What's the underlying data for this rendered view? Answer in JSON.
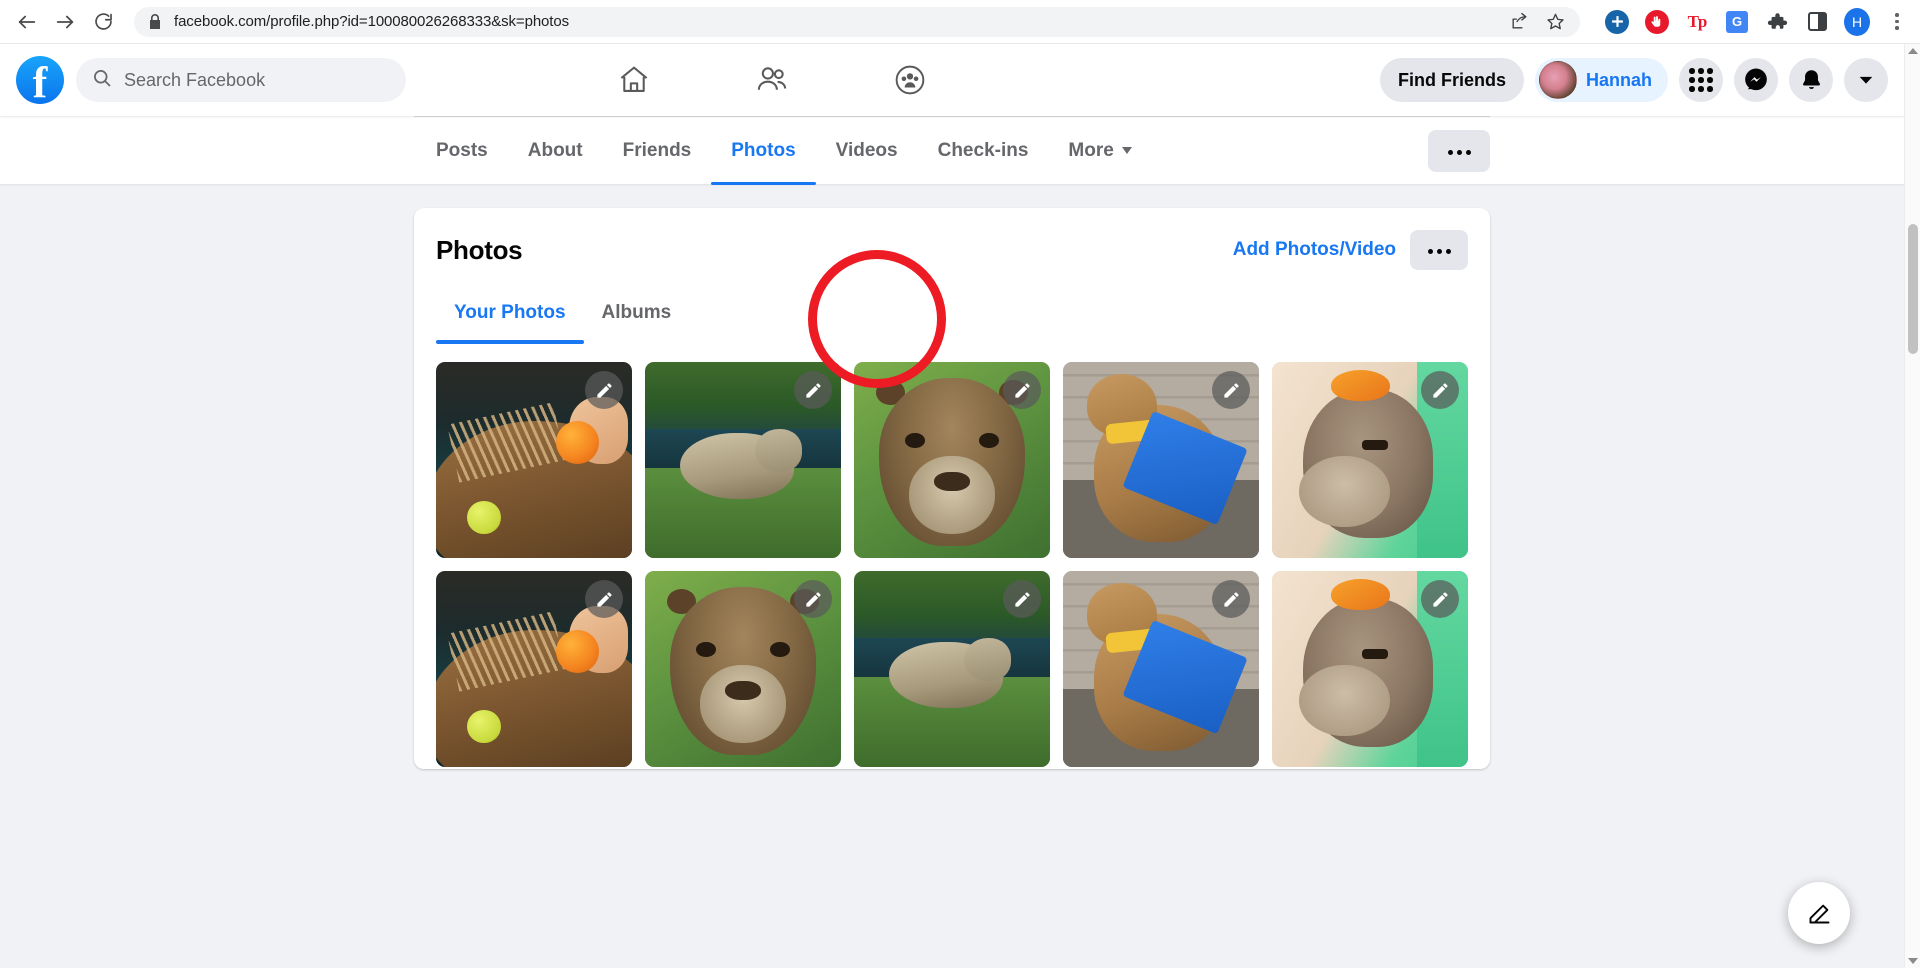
{
  "browser": {
    "back_icon": "back-arrow-icon",
    "forward_icon": "forward-arrow-icon",
    "reload_icon": "reload-icon",
    "lock_icon": "lock-icon",
    "url": "facebook.com/profile.php?id=100080026268333&sk=photos",
    "share_icon": "share-icon",
    "bookmark_icon": "star-icon",
    "extensions": [
      {
        "name": "colorzilla-extension-icon",
        "label": "",
        "color": "#1565a8"
      },
      {
        "name": "adblock-extension-icon",
        "label": "",
        "color": "#e8192c"
      },
      {
        "name": "textpower-extension-icon",
        "label": "Tp",
        "color": "#e8192c"
      },
      {
        "name": "google-translate-extension-icon",
        "label": "G",
        "color": "#4285f4"
      },
      {
        "name": "puzzle-extensions-icon",
        "label": "",
        "color": "#3c4043"
      },
      {
        "name": "side-panel-icon",
        "label": "",
        "color": "#3c4043"
      },
      {
        "name": "chrome-profile-avatar",
        "label": "H",
        "color": "#1a73e8"
      },
      {
        "name": "chrome-menu-kebab-icon",
        "label": "",
        "color": "#5f6368"
      }
    ]
  },
  "facebook_header": {
    "logo": "facebook-logo-icon",
    "search_placeholder": "Search Facebook",
    "search_icon": "search-icon",
    "nav_icons": [
      {
        "name": "home-icon"
      },
      {
        "name": "friends-icon"
      },
      {
        "name": "groups-icon"
      }
    ],
    "find_friends_label": "Find Friends",
    "profile_name": "Hannah",
    "right_icons": [
      {
        "name": "menu-grid-icon"
      },
      {
        "name": "messenger-icon"
      },
      {
        "name": "notifications-bell-icon"
      },
      {
        "name": "account-chevron-down-icon"
      }
    ]
  },
  "profile_nav": {
    "tabs": [
      {
        "label": "Posts",
        "active": false
      },
      {
        "label": "About",
        "active": false
      },
      {
        "label": "Friends",
        "active": false
      },
      {
        "label": "Photos",
        "active": true
      },
      {
        "label": "Videos",
        "active": false
      },
      {
        "label": "Check-ins",
        "active": false
      },
      {
        "label": "More",
        "active": false,
        "has_caret": true
      }
    ],
    "more_options_label": "..."
  },
  "photos_card": {
    "title": "Photos",
    "add_photos_label": "Add Photos/Video",
    "more_label": "...",
    "tabs": [
      {
        "label": "Your Photos",
        "active": true
      },
      {
        "label": "Albums",
        "active": false,
        "annotated": true
      }
    ],
    "annotation": {
      "shape": "circle",
      "color": "#ed1c24",
      "targets": "Albums"
    },
    "grid": {
      "columns": 5,
      "photos": [
        {
          "id": "photo-1",
          "alt": "Capybara in water with orange on head",
          "variant": "a",
          "edit_icon": "pencil-icon"
        },
        {
          "id": "photo-2",
          "alt": "Capybara resting on grass by pond",
          "variant": "b",
          "edit_icon": "pencil-icon"
        },
        {
          "id": "photo-3",
          "alt": "Capybara facing camera on green background",
          "variant": "c",
          "edit_icon": "pencil-icon"
        },
        {
          "id": "photo-4",
          "alt": "Capybara wearing blue and yellow scarf on stone wall",
          "variant": "d",
          "edit_icon": "pencil-icon"
        },
        {
          "id": "photo-5",
          "alt": "Capybara with orange duck on head",
          "variant": "e",
          "edit_icon": "pencil-icon"
        },
        {
          "id": "photo-6",
          "alt": "Capybara in water with orange on head",
          "variant": "a",
          "edit_icon": "pencil-icon"
        },
        {
          "id": "photo-7",
          "alt": "Capybara facing camera on green background",
          "variant": "c",
          "edit_icon": "pencil-icon"
        },
        {
          "id": "photo-8",
          "alt": "Capybara resting on grass by pond",
          "variant": "b",
          "edit_icon": "pencil-icon"
        },
        {
          "id": "photo-9",
          "alt": "Capybara wearing blue and yellow scarf on stone wall",
          "variant": "d",
          "edit_icon": "pencil-icon"
        },
        {
          "id": "photo-10",
          "alt": "Capybara with orange duck on head",
          "variant": "e",
          "edit_icon": "pencil-icon"
        }
      ]
    }
  },
  "floating_button": {
    "name": "compose-post-fab",
    "icon": "pencil-square-icon"
  },
  "colors": {
    "fb_blue": "#1877f2",
    "page_bg": "#f0f2f5",
    "card_bg": "#ffffff",
    "text_primary": "#050505",
    "text_secondary": "#65676b",
    "annotation_red": "#ed1c24"
  }
}
